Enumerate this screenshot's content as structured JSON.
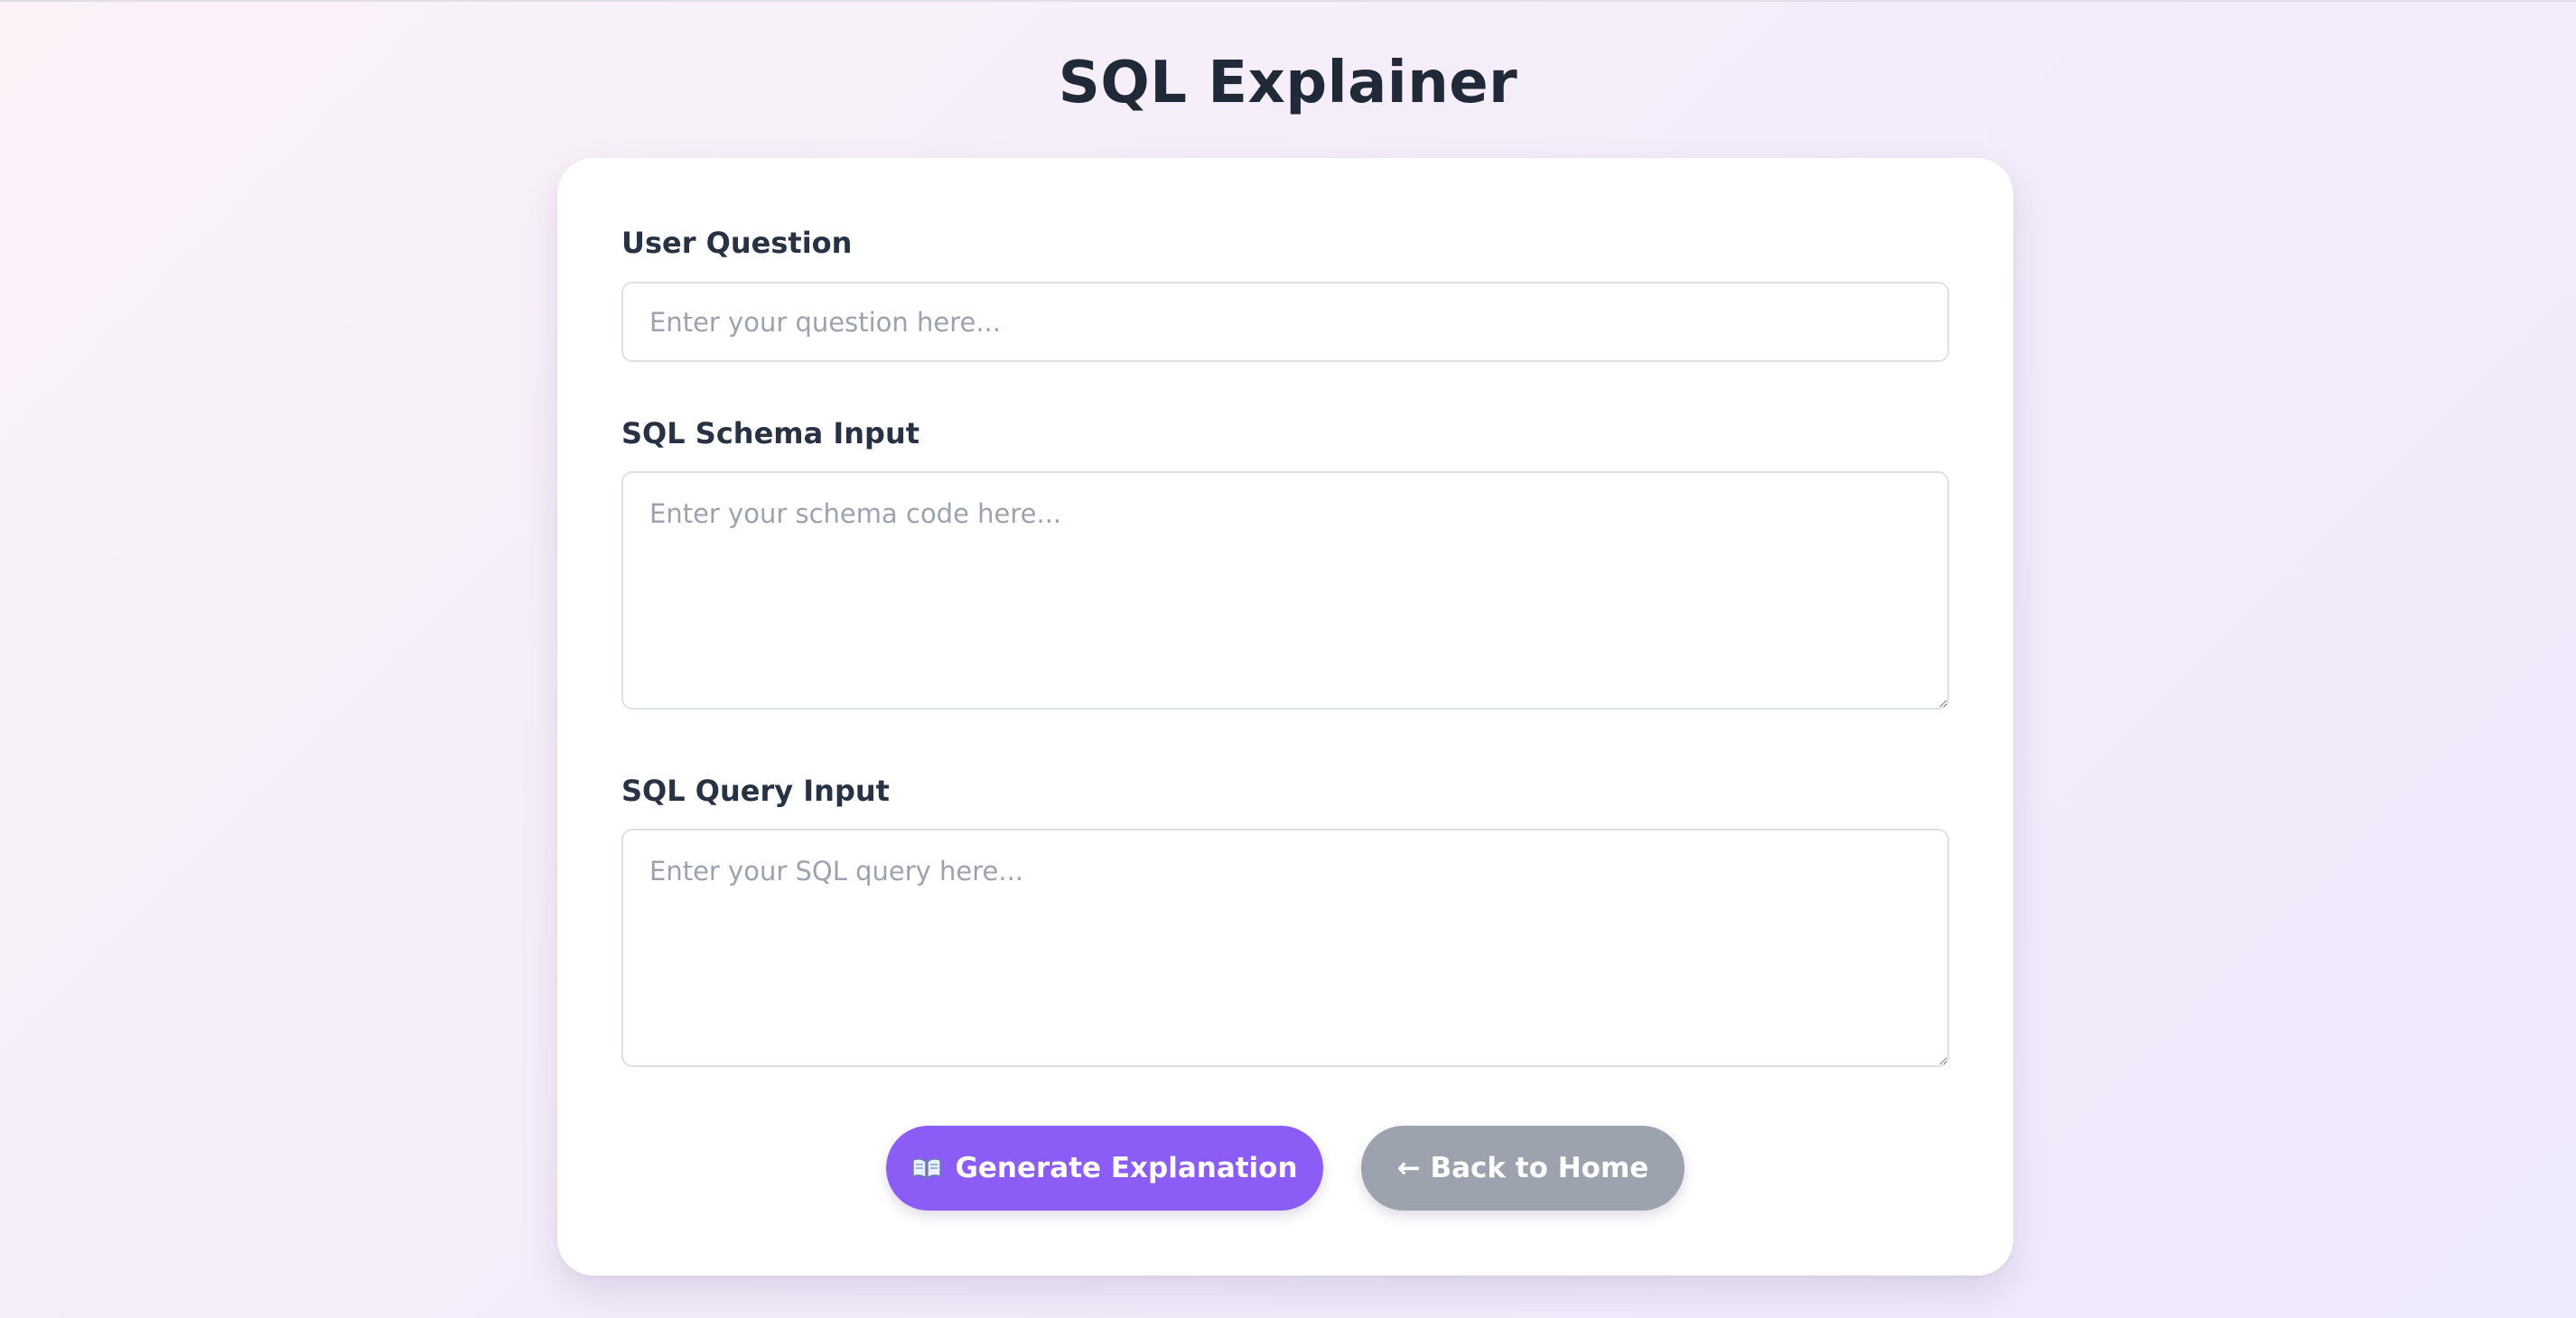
{
  "page": {
    "title": "SQL Explainer"
  },
  "form": {
    "question": {
      "label": "User Question",
      "placeholder": "Enter your question here...",
      "value": ""
    },
    "schema": {
      "label": "SQL Schema Input",
      "placeholder": "Enter your schema code here...",
      "value": ""
    },
    "query": {
      "label": "SQL Query Input",
      "placeholder": "Enter your SQL query here...",
      "value": ""
    }
  },
  "actions": {
    "generate": {
      "icon": "open-book-icon",
      "label": "Generate Explanation"
    },
    "back": {
      "label": "← Back to Home"
    }
  },
  "colors": {
    "primary": "#8b5cf6",
    "secondary": "#9ca3af",
    "title": "#1f2937"
  }
}
